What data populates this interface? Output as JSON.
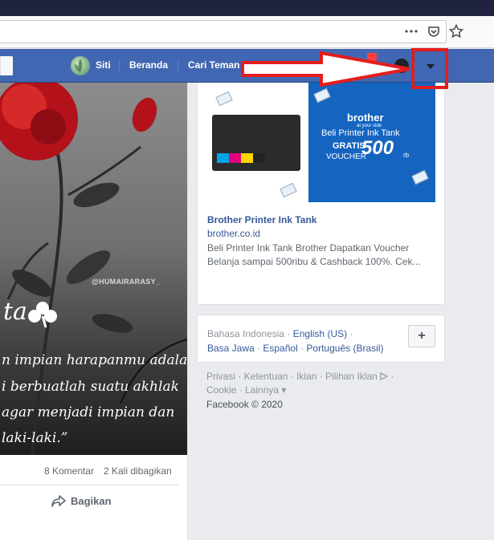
{
  "browser": {
    "menu_icon": "ellipsis-icon",
    "pocket_icon": "pocket-icon",
    "bookmark_icon": "star-icon"
  },
  "navbar": {
    "user_name": "Siti",
    "home_label": "Beranda",
    "find_friends_label": "Cari Teman",
    "dropdown_icon": "caret-down-icon",
    "help_icon": "help-icon"
  },
  "post": {
    "image_watermark": "@HUMAIRARASY_",
    "image_word": "ta",
    "image_lines": [
      "n impian harapanmu adalah",
      "i berbuatlah suatu akhlak",
      "agar menjadi impian dan",
      "laki-laki.”"
    ],
    "comments": "8 Komentar",
    "shares": "2 Kali dibagikan",
    "share_button": "Bagikan"
  },
  "ad": {
    "image_brand": "brother",
    "image_subbrand": "at your side",
    "image_line1": "Beli Printer Ink Tank",
    "image_line2": "GRATIS",
    "image_line3": "VOUCHER",
    "image_amount": "500",
    "image_unit": "rb",
    "title": "Brother Printer Ink Tank",
    "domain": "brother.co.id",
    "description": "Beli Printer Ink Tank Brother Dapatkan Voucher Belanja sampai 500ribu & Cashback 100%. Cek..."
  },
  "languages": {
    "current": "Bahasa Indonesia",
    "options": [
      "English (US)",
      "Basa Jawa",
      "Español",
      "Português (Brasil)"
    ],
    "add_label": "+"
  },
  "footer": {
    "links": [
      "Privasi",
      "Ketentuan",
      "Iklan",
      "Pilihan Iklan",
      "Cookie",
      "Lainnya"
    ],
    "copyright": "Facebook © 2020"
  },
  "colors": {
    "facebook_blue": "#4267b2",
    "annotation_red": "#e41d1d",
    "link_blue": "#365899"
  }
}
